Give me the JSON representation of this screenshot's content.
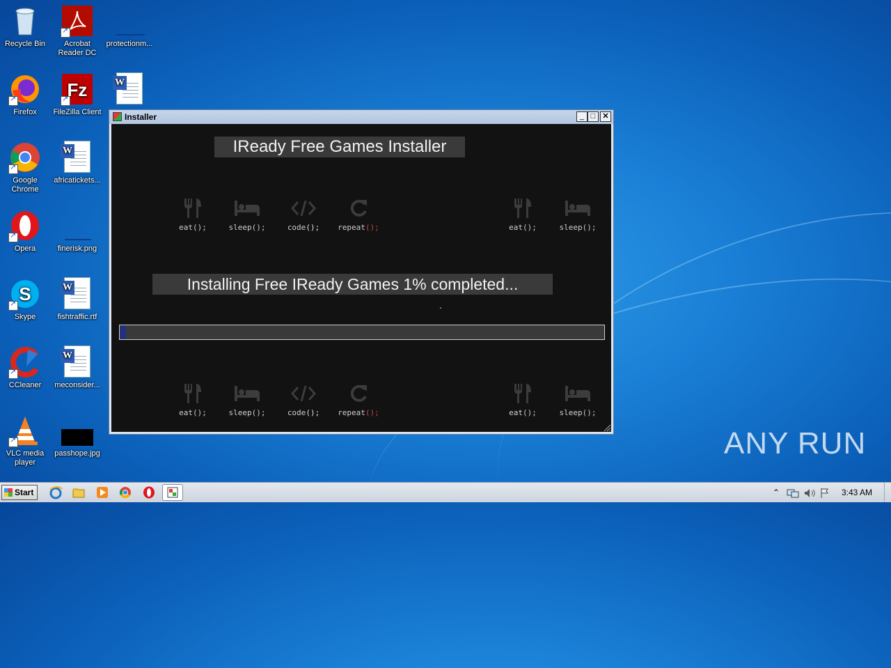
{
  "desktop": {
    "icons": [
      {
        "label": "Recycle Bin"
      },
      {
        "label": "Acrobat Reader DC"
      },
      {
        "label": "protectionm..."
      },
      {
        "label": "Firefox"
      },
      {
        "label": "FileZilla Client"
      },
      {
        "label": "Google Chrome"
      },
      {
        "label": "africatickets..."
      },
      {
        "label": "Opera"
      },
      {
        "label": "finerisk.png"
      },
      {
        "label": "Skype"
      },
      {
        "label": "fishtraffic.rtf"
      },
      {
        "label": "CCleaner"
      },
      {
        "label": "meconsider..."
      },
      {
        "label": "VLC media player"
      },
      {
        "label": "passhope.jpg"
      }
    ]
  },
  "window": {
    "title": "Installer",
    "heading": "IReady Free Games Installer",
    "status": "Installing Free IReady Games 1% completed...",
    "progress_percent": 1,
    "activities": {
      "eat": "eat",
      "sleep": "sleep",
      "code": "code",
      "repeat": "repeat",
      "suffix": "();"
    }
  },
  "taskbar": {
    "start_label": "Start",
    "clock": "3:43 AM"
  },
  "watermark": "ANY RUN"
}
